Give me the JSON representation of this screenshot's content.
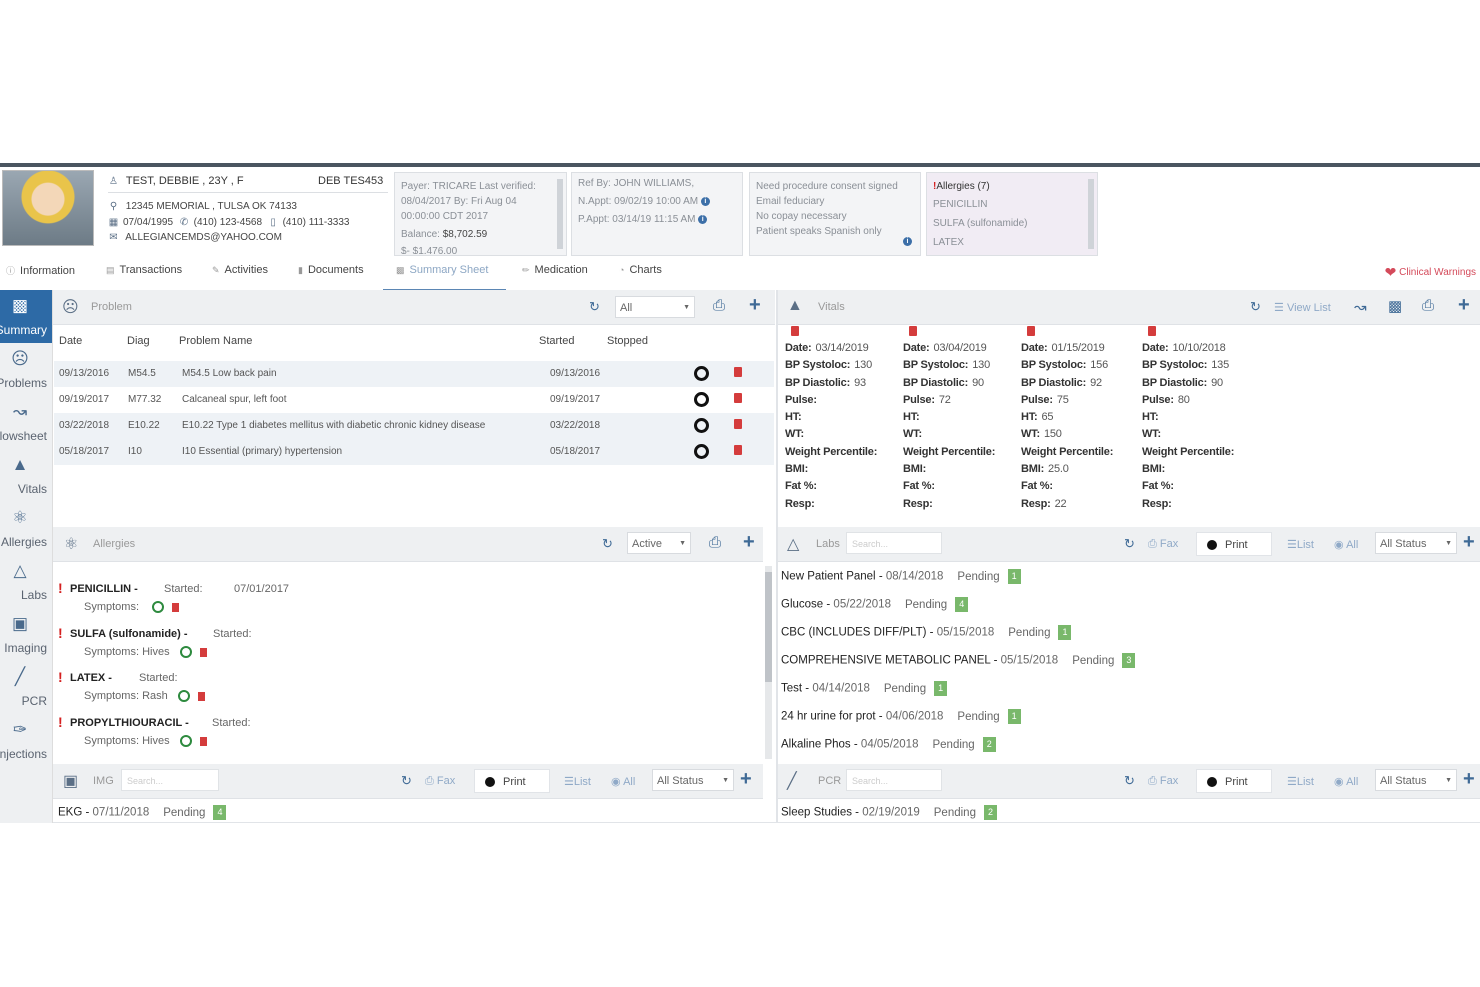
{
  "patient": {
    "name": "TEST, DEBBIE , 23Y , F",
    "id": "DEB TES453",
    "address": "12345 MEMORIAL , TULSA OK 74133",
    "dob": "07/04/1995",
    "phone": "(410) 123-4568",
    "mobile": "(410) 111-3333",
    "email": "ALLEGIANCEMDS@YAHOO.COM"
  },
  "payer_card": {
    "line1": "Payer: TRICARE Last verified:",
    "line2": "08/04/2017 By: Fri Aug 04",
    "line3": "00:00:00 CDT 2017",
    "balance_label": "Balance:",
    "balance_value": "$8,702.59",
    "line5": "$- $1,476.00"
  },
  "ref_card": {
    "ref": "Ref By: JOHN WILLIAMS,",
    "next_appt": "N.Appt: 09/02/19 10:00 AM",
    "prev_appt": "P.Appt: 03/14/19 11:15 AM"
  },
  "notes_card": {
    "l1": "Need procedure consent signed",
    "l2": "Email feduciary",
    "l3": "No copay necessary",
    "l4": "Patient speaks Spanish only"
  },
  "allergy_card": {
    "title": "Allergies (7)",
    "items": [
      "PENICILLIN",
      "SULFA (sulfonamide)",
      "LATEX"
    ]
  },
  "tabs": [
    "Information",
    "Transactions",
    "Activities",
    "Documents",
    "Summary Sheet",
    "Medication",
    "Charts"
  ],
  "clinical_warnings": "Clinical Warnings",
  "sidebar": [
    "Summary",
    "Problems",
    "Flowsheet",
    "Vitals",
    "Allergies",
    "Labs",
    "Imaging",
    "PCR",
    "Injections"
  ],
  "problem": {
    "title": "Problem",
    "filter": "All",
    "columns": [
      "Date",
      "Diag",
      "Problem Name",
      "Started",
      "Stopped"
    ],
    "rows": [
      {
        "date": "09/13/2016",
        "diag": "M54.5",
        "name": "M54.5 Low back pain",
        "started": "09/13/2016"
      },
      {
        "date": "09/19/2017",
        "diag": "M77.32",
        "name": "Calcaneal spur, left foot",
        "started": "09/19/2017"
      },
      {
        "date": "03/22/2018",
        "diag": "E10.22",
        "name": "E10.22 Type 1 diabetes mellitus with diabetic chronic kidney disease",
        "started": "03/22/2018"
      },
      {
        "date": "05/18/2017",
        "diag": "I10",
        "name": "I10 Essential (primary) hypertension",
        "started": "05/18/2017"
      }
    ]
  },
  "vitals": {
    "title": "Vitals",
    "view_list": "View List",
    "labels": [
      "Date:",
      "BP Systoloc:",
      "BP Diastolic:",
      "Pulse:",
      "HT:",
      "WT:",
      "Weight Percentile:",
      "BMI:",
      "Fat %:",
      "Resp:"
    ],
    "columns": [
      [
        "03/14/2019",
        "130",
        "93",
        "",
        "",
        "",
        "",
        "",
        "",
        ""
      ],
      [
        "03/04/2019",
        "130",
        "90",
        "72",
        "",
        "",
        "",
        "",
        "",
        ""
      ],
      [
        "01/15/2019",
        "156",
        "92",
        "75",
        "65",
        "150",
        "",
        "25.0",
        "",
        "22"
      ],
      [
        "10/10/2018",
        "135",
        "90",
        "80",
        "",
        "",
        "",
        "",
        "",
        ""
      ]
    ]
  },
  "allergies": {
    "title": "Allergies",
    "filter": "Active",
    "started_label": "Started:",
    "symptoms_label": "Symptoms:",
    "items": [
      {
        "name": "PENICILLIN -",
        "started": "07/01/2017",
        "symptoms": ""
      },
      {
        "name": "SULFA (sulfonamide) -",
        "started": "",
        "symptoms": "Hives"
      },
      {
        "name": "LATEX -",
        "started": "",
        "symptoms": "Rash"
      },
      {
        "name": "PROPYLTHIOURACIL -",
        "started": "",
        "symptoms": "Hives"
      }
    ]
  },
  "labs": {
    "title": "Labs",
    "search_placeholder": "Search...",
    "fax": "Fax",
    "print": "Print",
    "list": "List",
    "all": "All",
    "status": "All Status",
    "items": [
      {
        "name": "New Patient Panel",
        "date": "08/14/2018",
        "status": "Pending",
        "count": "1"
      },
      {
        "name": "Glucose",
        "date": "05/22/2018",
        "status": "Pending",
        "count": "4"
      },
      {
        "name": "CBC (INCLUDES DIFF/PLT)",
        "date": "05/15/2018",
        "status": "Pending",
        "count": "1"
      },
      {
        "name": "COMPREHENSIVE METABOLIC PANEL",
        "date": "05/15/2018",
        "status": "Pending",
        "count": "3"
      },
      {
        "name": "Test",
        "date": "04/14/2018",
        "status": "Pending",
        "count": "1"
      },
      {
        "name": "24 hr urine for prot",
        "date": "04/06/2018",
        "status": "Pending",
        "count": "1"
      },
      {
        "name": "Alkaline Phos",
        "date": "04/05/2018",
        "status": "Pending",
        "count": "2"
      }
    ]
  },
  "img": {
    "title": "IMG",
    "search_placeholder": "Search...",
    "fax": "Fax",
    "print": "Print",
    "list": "List",
    "all": "All",
    "status": "All Status",
    "items": [
      {
        "name": "EKG",
        "date": "07/11/2018",
        "status": "Pending",
        "count": "4"
      }
    ]
  },
  "pcr": {
    "title": "PCR",
    "search_placeholder": "Search...",
    "fax": "Fax",
    "print": "Print",
    "list": "List",
    "all": "All",
    "status": "All Status",
    "items": [
      {
        "name": "Sleep Studies",
        "date": "02/19/2019",
        "status": "Pending",
        "count": "2"
      }
    ]
  },
  "colors": {
    "accent": "#2d6aa6",
    "danger": "#d43c3c",
    "badge": "#79b86b"
  }
}
